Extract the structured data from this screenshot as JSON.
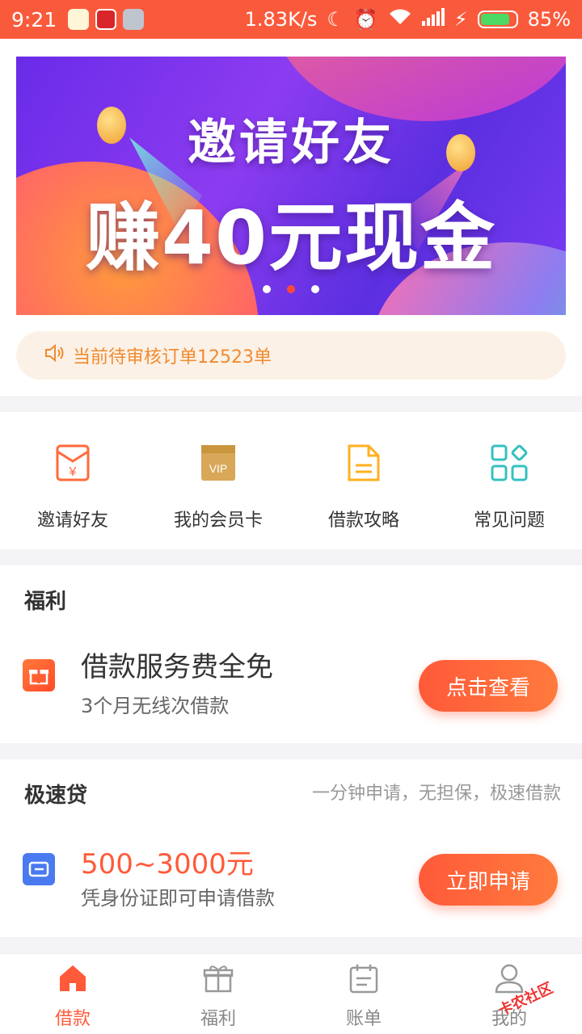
{
  "status_bar": {
    "time": "9:21",
    "speed": "1.83K/s",
    "battery_pct": "85%",
    "battery_level": 0.85
  },
  "banner": {
    "title_line1": "邀请好友",
    "title_line2": "赚40元现金",
    "dots": [
      {
        "active": false
      },
      {
        "active": true
      },
      {
        "active": false
      }
    ]
  },
  "notice": {
    "text": "当前待审核订单12523单",
    "icon": "speaker-icon"
  },
  "menu": [
    {
      "label": "邀请好友",
      "icon": "red-envelope-icon",
      "color": "#ff6a3a"
    },
    {
      "label": "我的会员卡",
      "icon": "vip-card-icon",
      "color": "#d8a858"
    },
    {
      "label": "借款攻略",
      "icon": "document-icon",
      "color": "#ffb020"
    },
    {
      "label": "常见问题",
      "icon": "grid-icon",
      "color": "#35c0c0"
    }
  ],
  "welfare": {
    "section_title": "福利",
    "main_text": "借款服务费全免",
    "sub_text": "3个月无线次借款",
    "button_label": "点击查看",
    "icon": "gift-icon"
  },
  "quick_loan": {
    "section_title": "极速贷",
    "section_subtitle": "一分钟申请，无担保，极速借款",
    "amount_text": "500~3000元",
    "sub_text": "凭身份证即可申请借款",
    "button_label": "立即申请",
    "icon": "wallet-icon"
  },
  "tabs": [
    {
      "label": "借款",
      "icon": "home-icon",
      "active": true
    },
    {
      "label": "福利",
      "icon": "gift-icon",
      "active": false
    },
    {
      "label": "账单",
      "icon": "calendar-icon",
      "active": false
    },
    {
      "label": "我的",
      "icon": "user-icon",
      "active": false
    }
  ],
  "watermark_text": "卡农社区",
  "colors": {
    "accent": "#fa5a3c",
    "notice_text": "#f08a30",
    "amount": "#ff5a3a"
  }
}
